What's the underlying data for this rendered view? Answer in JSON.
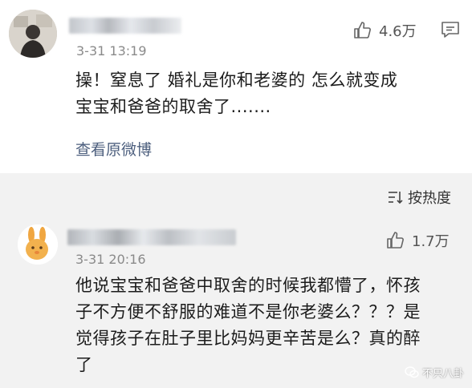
{
  "comment1": {
    "time": "3-31 13:19",
    "likes": "4.6万",
    "line1": "操！窒息了 婚礼是你和老婆的 怎么就变成",
    "line2": "宝宝和爸爸的取舍了.......",
    "view_original": "查看原微博"
  },
  "sort": {
    "label": "按热度"
  },
  "comment2": {
    "time": "3-31 20:16",
    "likes": "1.7万",
    "line1": "他说宝宝和爸爸中取舍的时候我都懵了，怀孩",
    "line2": "子不方便不舒服的难道不是你老婆么？？？是",
    "line3": "觉得孩子在肚子里比妈妈更辛苦是么？真的醉",
    "line4": "了"
  },
  "watermark": {
    "text": "不只八卦"
  },
  "colors": {
    "background": "#f2f2f2",
    "card": "#ffffff",
    "link": "#4d5f7e",
    "meta": "#8a8a8a"
  },
  "icons": [
    "thumbs-up-icon",
    "comment-icon",
    "sort-icon",
    "wechat-icon"
  ]
}
